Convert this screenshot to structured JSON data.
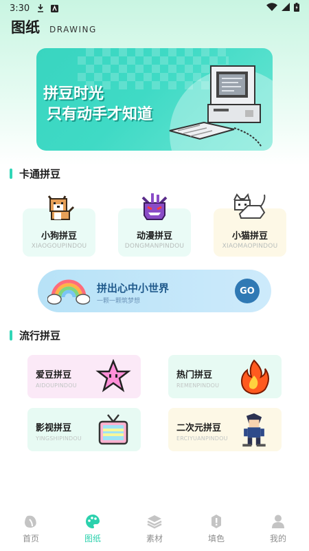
{
  "status_bar": {
    "time": "3:30"
  },
  "header": {
    "title": "图纸",
    "subtitle": "DRAWING"
  },
  "banner": {
    "line1": "拼豆时光",
    "line2": "只有动手才知道"
  },
  "section_cartoon": {
    "title": "卡通拼豆",
    "items": [
      {
        "name": "小狗拼豆",
        "pinyin": "XIAOGOUPINDOU",
        "icon": "dog-icon",
        "bg": "#eafbf6"
      },
      {
        "name": "动漫拼豆",
        "pinyin": "DONGMANPINDOU",
        "icon": "gengar-icon",
        "bg": "#eafbf6"
      },
      {
        "name": "小猫拼豆",
        "pinyin": "XIAOMAOPINDOU",
        "icon": "cat-icon",
        "bg": "#fdf8e6"
      }
    ]
  },
  "go_banner": {
    "text": "拼出心中小世界",
    "sub": "一颗一颗筑梦想",
    "go": "GO"
  },
  "section_popular": {
    "title": "流行拼豆",
    "items": [
      {
        "name": "爱豆拼豆",
        "pinyin": "AIDOUPINDOU",
        "icon": "star-icon",
        "bg": "#fbe9f7"
      },
      {
        "name": "热门拼豆",
        "pinyin": "REMENPINDOU",
        "icon": "fire-icon",
        "bg": "#e7faf3"
      },
      {
        "name": "影视拼豆",
        "pinyin": "YINGSHIPINDOU",
        "icon": "tv-icon",
        "bg": "#e7faf3"
      },
      {
        "name": "二次元拼豆",
        "pinyin": "ERCIYUANPINDOU",
        "icon": "ninja-icon",
        "bg": "#fdf8e6"
      }
    ]
  },
  "tabs": [
    {
      "label": "首页",
      "icon": "bean-icon",
      "active": false
    },
    {
      "label": "图纸",
      "icon": "palette-icon",
      "active": true
    },
    {
      "label": "素材",
      "icon": "layers-icon",
      "active": false
    },
    {
      "label": "填色",
      "icon": "bucket-icon",
      "active": false
    },
    {
      "label": "我的",
      "icon": "user-icon",
      "active": false
    }
  ],
  "colors": {
    "accent": "#2bd1ad",
    "tab_inactive": "#8e8e8e",
    "go_button": "#2f79b4"
  }
}
